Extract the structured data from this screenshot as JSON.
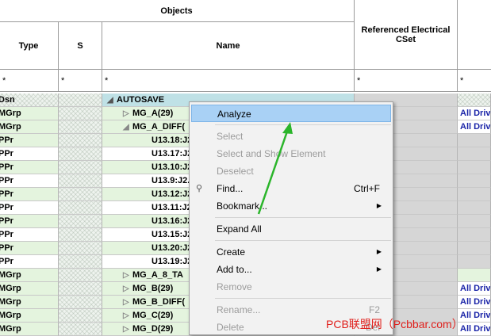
{
  "header": {
    "objects": "Objects",
    "type": "Type",
    "s": "S",
    "name": "Name",
    "ref_cset": "Referenced Electrical CSet"
  },
  "filters": {
    "type": "*",
    "s": "*",
    "name": "*",
    "ref": "*",
    "last": "*"
  },
  "rows": [
    {
      "type": "Dsn",
      "name": "AUTOSAVE",
      "last": "",
      "style": "hatch",
      "expander": "open-dark"
    },
    {
      "type": "MGrp",
      "name": "MG_A(29)",
      "last": "All Driv",
      "style": "green",
      "expander": "closed"
    },
    {
      "type": "MGrp",
      "name": "MG_A_DIFF(",
      "last": "All Driv",
      "style": "green",
      "expander": "open"
    },
    {
      "type": "PPr",
      "name": "U13.18:J2",
      "last": "",
      "style": "green"
    },
    {
      "type": "PPr",
      "name": "U13.17:J2",
      "last": "",
      "style": "white"
    },
    {
      "type": "PPr",
      "name": "U13.10:J2",
      "last": "",
      "style": "green"
    },
    {
      "type": "PPr",
      "name": "U13.9:J2.",
      "last": "",
      "style": "white"
    },
    {
      "type": "PPr",
      "name": "U13.12:J2",
      "last": "",
      "style": "green"
    },
    {
      "type": "PPr",
      "name": "U13.11:J2",
      "last": "",
      "style": "white"
    },
    {
      "type": "PPr",
      "name": "U13.16:J2",
      "last": "",
      "style": "green"
    },
    {
      "type": "PPr",
      "name": "U13.15:J2",
      "last": "",
      "style": "white"
    },
    {
      "type": "PPr",
      "name": "U13.20:J2",
      "last": "",
      "style": "green"
    },
    {
      "type": "PPr",
      "name": "U13.19:J2",
      "last": "",
      "style": "white"
    },
    {
      "type": "MGrp",
      "name": "MG_A_8_TA",
      "last": "",
      "style": "green",
      "expander": "closed"
    },
    {
      "type": "MGrp",
      "name": "MG_B(29)",
      "last": "All Driv",
      "style": "green",
      "expander": "closed"
    },
    {
      "type": "MGrp",
      "name": "MG_B_DIFF(",
      "last": "All Driv",
      "style": "green",
      "expander": "closed"
    },
    {
      "type": "MGrp",
      "name": "MG_C(29)",
      "last": "All Driv",
      "style": "green",
      "expander": "closed"
    },
    {
      "type": "MGrp",
      "name": "MG_D(29)",
      "last": "All Driv",
      "style": "green",
      "expander": "closed"
    }
  ],
  "menu": {
    "items": [
      {
        "label": "Analyze",
        "state": "highlighted"
      },
      {
        "sep": true
      },
      {
        "label": "Select",
        "state": "disabled"
      },
      {
        "label": "Select and Show Element",
        "state": "disabled"
      },
      {
        "label": "Deselect",
        "state": "disabled"
      },
      {
        "label": "Find...",
        "shortcut": "Ctrl+F",
        "state": "enabled",
        "icon": "binoculars-icon"
      },
      {
        "label": "Bookmark...",
        "submenu": true,
        "state": "enabled"
      },
      {
        "sep": true
      },
      {
        "label": "Expand All",
        "state": "enabled"
      },
      {
        "sep": true
      },
      {
        "label": "Create",
        "submenu": true,
        "state": "enabled"
      },
      {
        "label": "Add to...",
        "submenu": true,
        "state": "enabled"
      },
      {
        "label": "Remove",
        "state": "disabled"
      },
      {
        "sep": true
      },
      {
        "label": "Rename...",
        "shortcut": "F2",
        "state": "disabled"
      },
      {
        "label": "Delete",
        "shortcut": "Del",
        "state": "disabled"
      }
    ]
  },
  "watermark": "PCB联盟网（Pcbbar.com）",
  "colors": {
    "highlight": "#a9d1f5",
    "row_green": "#e4f4de",
    "ref_gray": "#d6d6d6",
    "link_blue": "#1a24a8",
    "annotation_arrow": "#2bb52b",
    "watermark": "#e0201c"
  }
}
